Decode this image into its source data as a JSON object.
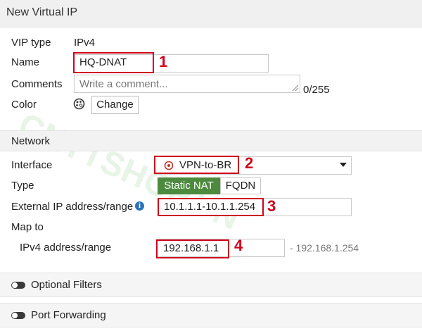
{
  "window": {
    "title": "New Virtual IP"
  },
  "form": {
    "vip_type_label": "VIP type",
    "vip_type_value": "IPv4",
    "name_label": "Name",
    "name_value": "HQ-DNAT",
    "comments_label": "Comments",
    "comments_placeholder": "Write a comment...",
    "comments_counter": "0/255",
    "color_label": "Color",
    "change_button": "Change"
  },
  "network": {
    "header": "Network",
    "interface_label": "Interface",
    "interface_value": "VPN-to-BR",
    "type_label": "Type",
    "type_options": [
      "Static NAT",
      "FQDN"
    ],
    "type_selected": "Static NAT",
    "external_label": "External IP address/range",
    "external_value": "10.1.1.1-10.1.1.254",
    "map_to_label": "Map to",
    "ipv4_label": "IPv4 address/range",
    "ipv4_value": "192.168.1.1",
    "ipv4_range_end": "- 192.168.1.254"
  },
  "sections": {
    "optional_filters": "Optional Filters",
    "port_forwarding": "Port Forwarding"
  },
  "annotations": [
    "1",
    "2",
    "3",
    "4"
  ],
  "watermark": "CNTTSHOP.VN",
  "colors": {
    "annotation_red": "#d0021b",
    "static_nat_green": "#4c8a3e",
    "info_blue": "#2d73b9",
    "interface_icon_red": "#c0392b"
  }
}
